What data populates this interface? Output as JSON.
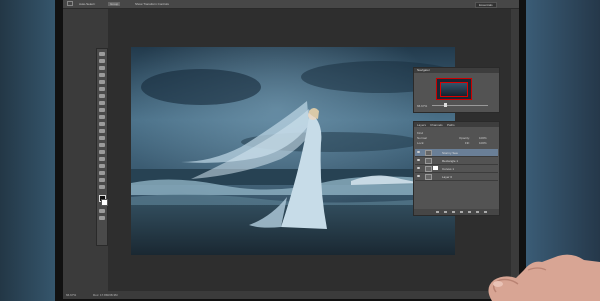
{
  "options_bar": {
    "mode_label": "Auto-Select:",
    "mode_value": "Group",
    "transform_label": "Show Transform Controls",
    "workspace": "Essentials"
  },
  "status_bar": {
    "zoom": "66.67%",
    "doc_size": "Doc: 17.8M/38.3M"
  },
  "navigator": {
    "title": "Navigator",
    "zoom": "66.67%"
  },
  "layers_panel": {
    "tabs": [
      "Layers",
      "Channels",
      "Paths"
    ],
    "kind_label": "Kind",
    "blend_mode": "Normal",
    "opacity_label": "Opacity:",
    "opacity_value": "100%",
    "lock_label": "Lock:",
    "fill_label": "Fill:",
    "fill_value": "100%",
    "layers": [
      {
        "name": "Stormy Sea",
        "selected": true,
        "has_mask": false
      },
      {
        "name": "Rectangle 1",
        "selected": false,
        "has_mask": false
      },
      {
        "name": "Curves 1",
        "selected": false,
        "has_mask": true
      },
      {
        "name": "Layer 0",
        "selected": false,
        "has_mask": false
      }
    ]
  },
  "colors": {
    "ui_background": "#3b3b3b",
    "panel": "#535353",
    "selection": "#6a7f97",
    "nav_frame": "#cc0000"
  }
}
